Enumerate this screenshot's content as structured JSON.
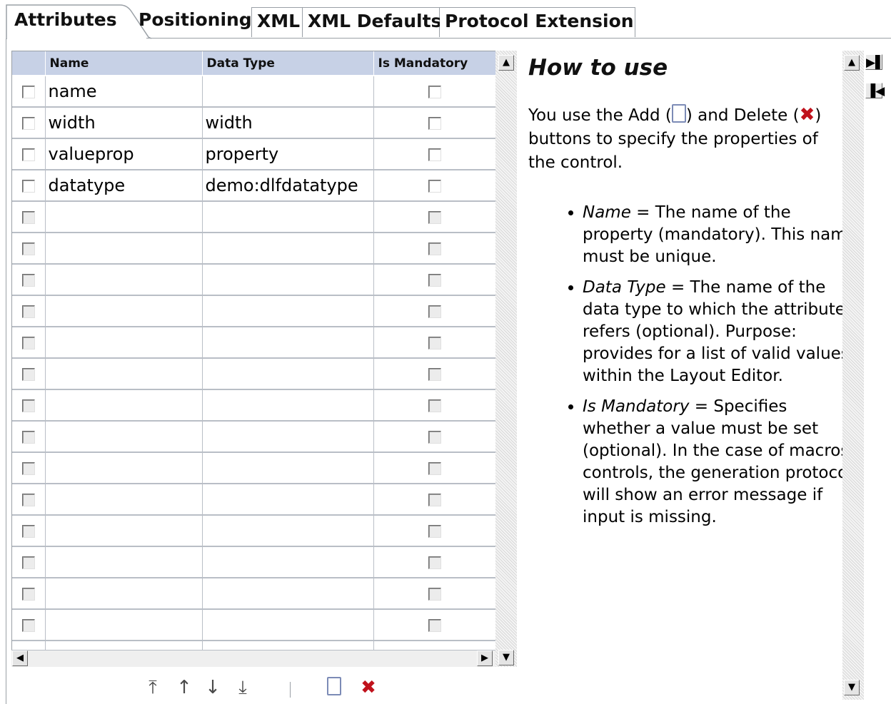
{
  "tabs": [
    "Attributes",
    "Positioning",
    "XML",
    "XML Defaults",
    "Protocol Extension"
  ],
  "grid": {
    "columns": [
      "Name",
      "Data Type",
      "Is Mandatory"
    ],
    "rows": [
      {
        "name": "name",
        "datatype": ""
      },
      {
        "name": "width",
        "datatype": "width"
      },
      {
        "name": "valueprop",
        "datatype": "property"
      },
      {
        "name": "datatype",
        "datatype": "demo:dlfdatatype"
      }
    ],
    "empty_rows": 15
  },
  "scroll": {
    "left": "◀",
    "right": "▶",
    "up": "▲",
    "down": "▼"
  },
  "toolbar": {
    "top": "⤒",
    "up": "↑",
    "down": "↓",
    "bottom": "⤓",
    "add": "",
    "delete": "✖"
  },
  "help": {
    "title": "How to use",
    "intro_1": "You use the Add (",
    "intro_2": ") and Delete (",
    "intro_3": ") buttons to specify the properties of the control.",
    "delete_glyph": "✖",
    "items": [
      {
        "term": "Name",
        "text": " = The name of the property (mandatory). This name must be unique."
      },
      {
        "term": "Data Type",
        "text": " = The name of the data type to which the attribute refers (optional). Purpose: provides for a list of valid values within the Layout Editor."
      },
      {
        "term": "Is Mandatory",
        "text": " = Specifies whether a value must be set (optional). In the case of macros controls, the generation protocol will show an error message if input is missing."
      }
    ]
  },
  "side_buttons": [
    "▶▌",
    "▐◀"
  ]
}
